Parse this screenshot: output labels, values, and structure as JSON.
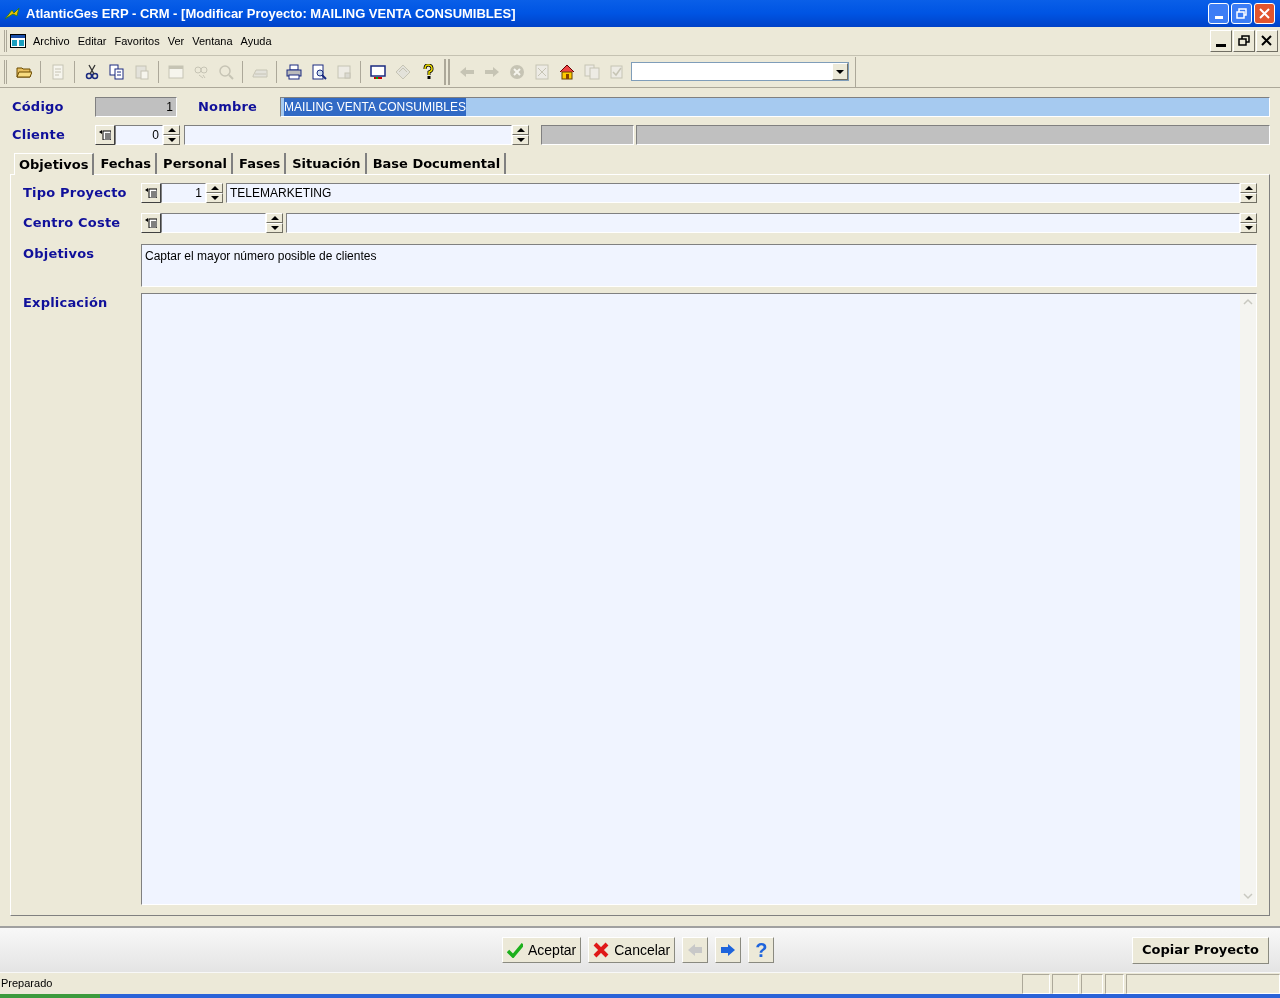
{
  "window": {
    "title": "AtlanticGes ERP - CRM - [Modificar Proyecto: MAILING VENTA CONSUMIBLES]"
  },
  "menu": [
    "Archivo",
    "Editar",
    "Favoritos",
    "Ver",
    "Ventana",
    "Ayuda"
  ],
  "toolbar": [
    [
      {
        "kind": "open",
        "disabled": false
      }
    ],
    [
      {
        "kind": "edit",
        "disabled": true
      }
    ],
    [
      {
        "kind": "cut",
        "disabled": false
      },
      {
        "kind": "copy",
        "disabled": false
      },
      {
        "kind": "paste",
        "disabled": true
      }
    ],
    [
      {
        "kind": "window",
        "disabled": true
      },
      {
        "kind": "find",
        "disabled": true
      },
      {
        "kind": "search",
        "disabled": true
      }
    ],
    [
      {
        "kind": "scanner",
        "disabled": true
      }
    ],
    [
      {
        "kind": "print",
        "disabled": false
      },
      {
        "kind": "preview",
        "disabled": false
      },
      {
        "kind": "page",
        "disabled": true
      }
    ],
    [
      {
        "kind": "monitor",
        "disabled": false
      },
      {
        "kind": "diamond",
        "disabled": true
      },
      {
        "kind": "help",
        "disabled": false
      }
    ],
    [
      {
        "kind": "back",
        "disabled": true
      },
      {
        "kind": "forward",
        "disabled": true
      },
      {
        "kind": "stop",
        "disabled": true
      },
      {
        "kind": "doc",
        "disabled": true
      },
      {
        "kind": "home",
        "disabled": false
      },
      {
        "kind": "docs",
        "disabled": true
      },
      {
        "kind": "check",
        "disabled": true
      }
    ]
  ],
  "header": {
    "codigo": {
      "label": "Código",
      "value": "1"
    },
    "nombre": {
      "label": "Nombre",
      "value": "MAILING VENTA CONSUMIBLES",
      "selected": true
    },
    "cliente": {
      "label": "Cliente",
      "value": "0"
    }
  },
  "tabs": [
    {
      "label": "Objetivos",
      "selected": true
    },
    {
      "label": "Fechas",
      "selected": false
    },
    {
      "label": "Personal",
      "selected": false
    },
    {
      "label": "Fases",
      "selected": false
    },
    {
      "label": "Situación",
      "selected": false
    },
    {
      "label": "Base Documental",
      "selected": false
    }
  ],
  "fields": {
    "tipo_proyecto": {
      "label": "Tipo Proyecto",
      "code": "1",
      "value": "TELEMARKETING"
    },
    "centro_coste": {
      "label": "Centro Coste"
    },
    "objetivos": {
      "label": "Objetivos",
      "value": "Captar el mayor número posible de clientes"
    },
    "explicacion": {
      "label": "Explicación"
    }
  },
  "buttons": [
    {
      "kind": "accept",
      "label": "Aceptar",
      "disabled": false
    },
    {
      "kind": "cancel",
      "label": "Cancelar",
      "disabled": false
    },
    {
      "kind": "back",
      "disabled": true
    },
    {
      "kind": "forward",
      "disabled": false
    },
    {
      "kind": "help",
      "label": "?",
      "disabled": false
    }
  ],
  "copy_button": "Copiar Proyecto",
  "status_bar": {
    "text": "Preparado"
  }
}
